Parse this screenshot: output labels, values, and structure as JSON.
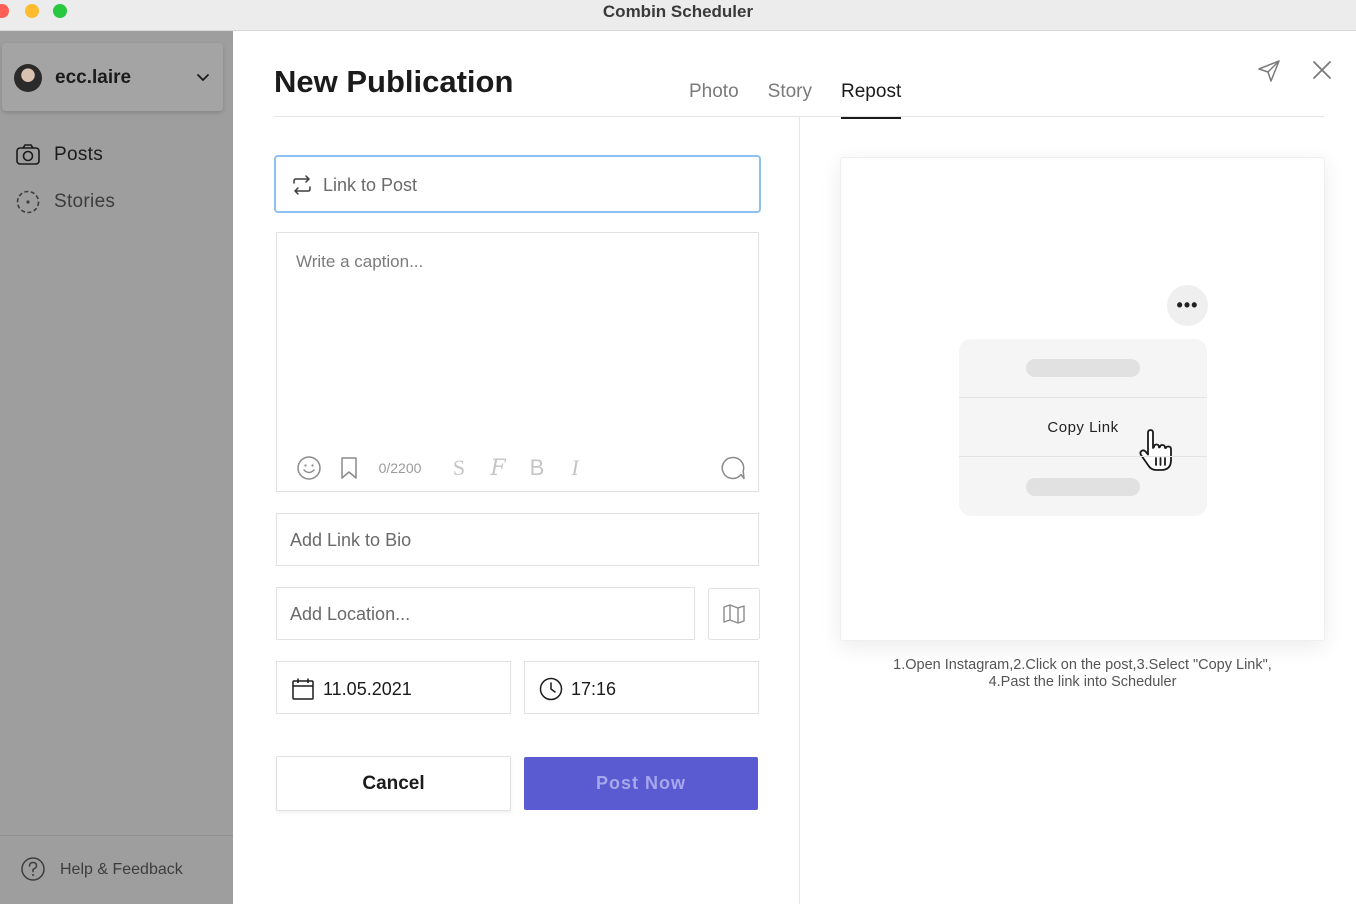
{
  "window": {
    "title": "Combin Scheduler"
  },
  "sidebar": {
    "account": {
      "name": "ecc.laire"
    },
    "items": [
      {
        "label": "Posts",
        "icon": "camera-icon"
      },
      {
        "label": "Stories",
        "icon": "stories-ring-icon"
      }
    ],
    "help": {
      "label": "Help & Feedback"
    }
  },
  "main": {
    "title": "New Publication",
    "tabs": [
      {
        "label": "Photo",
        "active": false
      },
      {
        "label": "Story",
        "active": false
      },
      {
        "label": "Repost",
        "active": true
      }
    ]
  },
  "form": {
    "link_placeholder": "Link to Post",
    "caption_placeholder": "Write a caption...",
    "char_counter": "0/2200",
    "bio_placeholder": "Add Link to Bio",
    "location_placeholder": "Add Location...",
    "date": "11.05.2021",
    "time": "17:16",
    "cancel_label": "Cancel",
    "post_label": "Post Now"
  },
  "preview": {
    "menu_item": "Copy Link",
    "instructions_line1": "1.Open Instagram,2.Click on the post,3.Select \"Copy Link\",",
    "instructions_line2": "4.Past the link into Scheduler"
  },
  "colors": {
    "accent": "#5a5bd1",
    "focus_border": "#8ec0f2",
    "sidebar_bg": "#9e9e9e"
  }
}
